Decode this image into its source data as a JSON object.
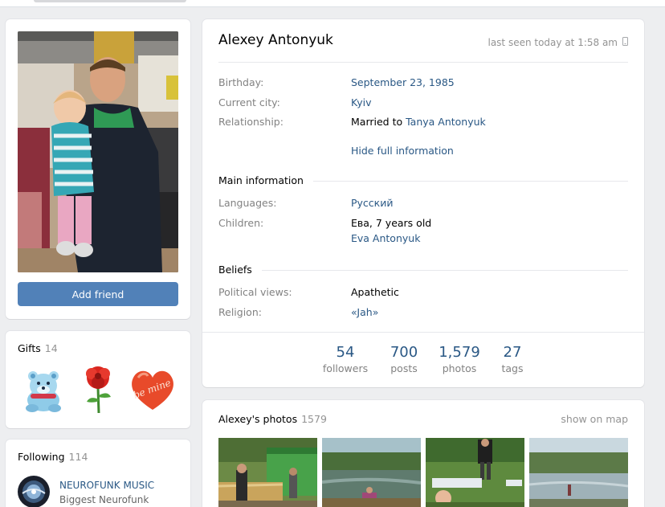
{
  "profile": {
    "name": "Alexey Antonyuk",
    "last_seen": "last seen today at 1:58 am",
    "add_friend": "Add friend"
  },
  "info": {
    "birthday_label": "Birthday:",
    "birthday_value": "September 23, 1985",
    "city_label": "Current city:",
    "city_value": "Kyiv",
    "relationship_label": "Relationship:",
    "relationship_prefix": "Married to ",
    "relationship_partner": "Tanya Antonyuk",
    "hide_full": "Hide full information"
  },
  "main_info": {
    "title": "Main information",
    "languages_label": "Languages:",
    "languages_value": "Русский",
    "children_label": "Children:",
    "child_1": "Ева, 7 years old",
    "child_2": "Eva Antonyuk"
  },
  "beliefs": {
    "title": "Beliefs",
    "political_label": "Political views:",
    "political_value": "Apathetic",
    "religion_label": "Religion:",
    "religion_value": "«Jah»"
  },
  "counters": [
    {
      "num": "54",
      "label": "followers"
    },
    {
      "num": "700",
      "label": "posts"
    },
    {
      "num": "1,579",
      "label": "photos"
    },
    {
      "num": "27",
      "label": "tags"
    }
  ],
  "gifts": {
    "title": "Gifts",
    "count": "14",
    "items": [
      "bear-gift-icon",
      "rose-gift-icon",
      "heart-be-mine-gift-icon"
    ],
    "heart_text": "be mine"
  },
  "following": {
    "title": "Following",
    "count": "114",
    "name": "NEUROFUNK MUSIC",
    "subtitle": "Biggest Neurofunk"
  },
  "photos": {
    "title": "Alexey's photos",
    "count": "1579",
    "show_on_map": "show on map"
  },
  "colors": {
    "accent": "#5181b8",
    "link": "#2a5885",
    "muted": "#828282",
    "background": "#edeef0"
  }
}
